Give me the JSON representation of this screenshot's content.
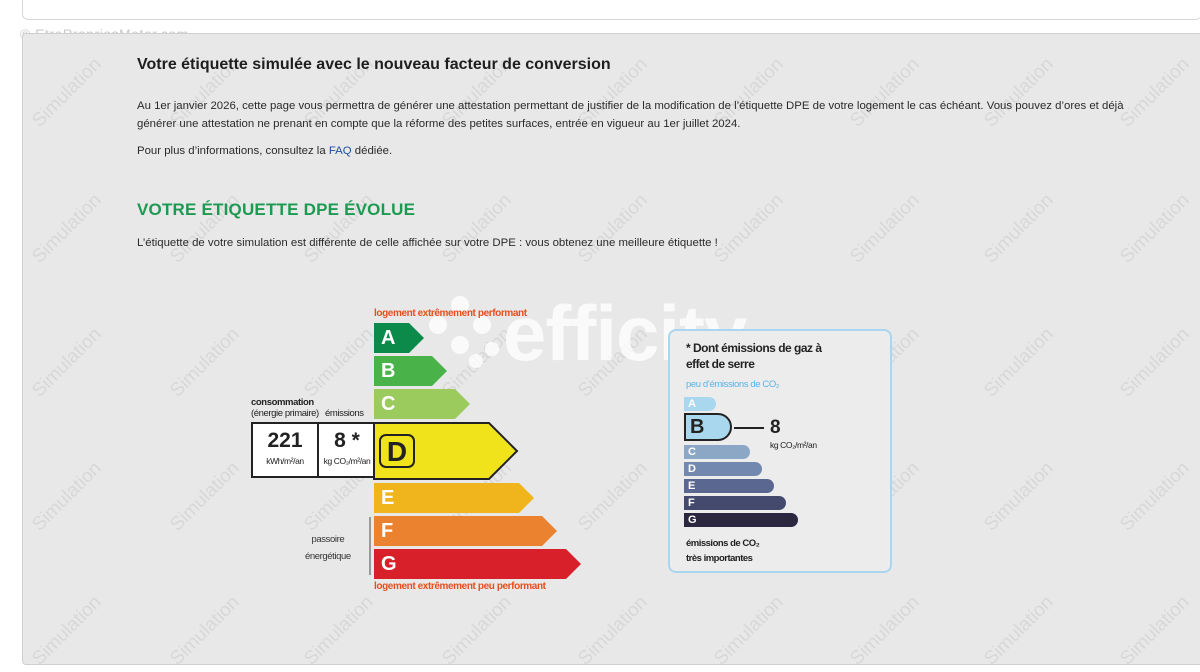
{
  "watermarks": {
    "source": "© EtrePropriosMeter.com",
    "simulation": "Simulation",
    "brand": "efficity"
  },
  "page": {
    "title": "Votre étiquette simulée avec le nouveau facteur de conversion",
    "para1": "Au 1er janvier 2026, cette page vous permettra de générer une attestation permettant de justifier de la modification de l’étiquette DPE de votre logement le cas échéant. Vous pouvez d’ores et déjà générer une attestation ne prenant en compte que la réforme des petites surfaces, entrée en vigueur au 1er juillet 2024.",
    "para2_before": "Pour plus d’informations, consultez la ",
    "faq_link": "FAQ",
    "para2_after": " dédiée.",
    "heading": "VOTRE ÉTIQUETTE DPE ÉVOLUE",
    "para3": "L’étiquette de votre simulation est différente de celle affichée sur votre DPE : vous obtenez une meilleure étiquette !"
  },
  "dpe": {
    "top_caption": "logement extrêmement performant",
    "bottom_caption": "logement extrêmement peu performant",
    "consumption_label": "consommation",
    "consumption_sub": "(énergie primaire)",
    "emissions_label": "émissions",
    "consumption_value": "221",
    "consumption_unit": "kWh/m²/an",
    "emissions_value": "8 *",
    "emissions_unit": "kg CO₂/m²/an",
    "passoire_line1": "passoire",
    "passoire_line2": "énergétique",
    "current": "D",
    "classes": [
      {
        "letter": "A",
        "color": "#0b8a4a"
      },
      {
        "letter": "B",
        "color": "#49b34a"
      },
      {
        "letter": "C",
        "color": "#9acb5c"
      },
      {
        "letter": "D",
        "color": "#f0e21b"
      },
      {
        "letter": "E",
        "color": "#f0b51c"
      },
      {
        "letter": "F",
        "color": "#ea8230"
      },
      {
        "letter": "G",
        "color": "#d8202a"
      }
    ]
  },
  "ges": {
    "title": "* Dont émissions de gaz à effet de serre",
    "top_label": "peu d’émissions de CO₂",
    "bottom_line1": "émissions de CO₂",
    "bottom_line2": "très importantes",
    "current": "B",
    "value": "8",
    "unit": "kg CO₂/m²/an",
    "classes": [
      {
        "letter": "A",
        "color": "#a8d7ee"
      },
      {
        "letter": "B",
        "color": "#a8d7ee"
      },
      {
        "letter": "C",
        "color": "#8ca7c6"
      },
      {
        "letter": "D",
        "color": "#7388af"
      },
      {
        "letter": "E",
        "color": "#5a6790"
      },
      {
        "letter": "F",
        "color": "#434a6e"
      },
      {
        "letter": "G",
        "color": "#2b2740"
      }
    ]
  }
}
